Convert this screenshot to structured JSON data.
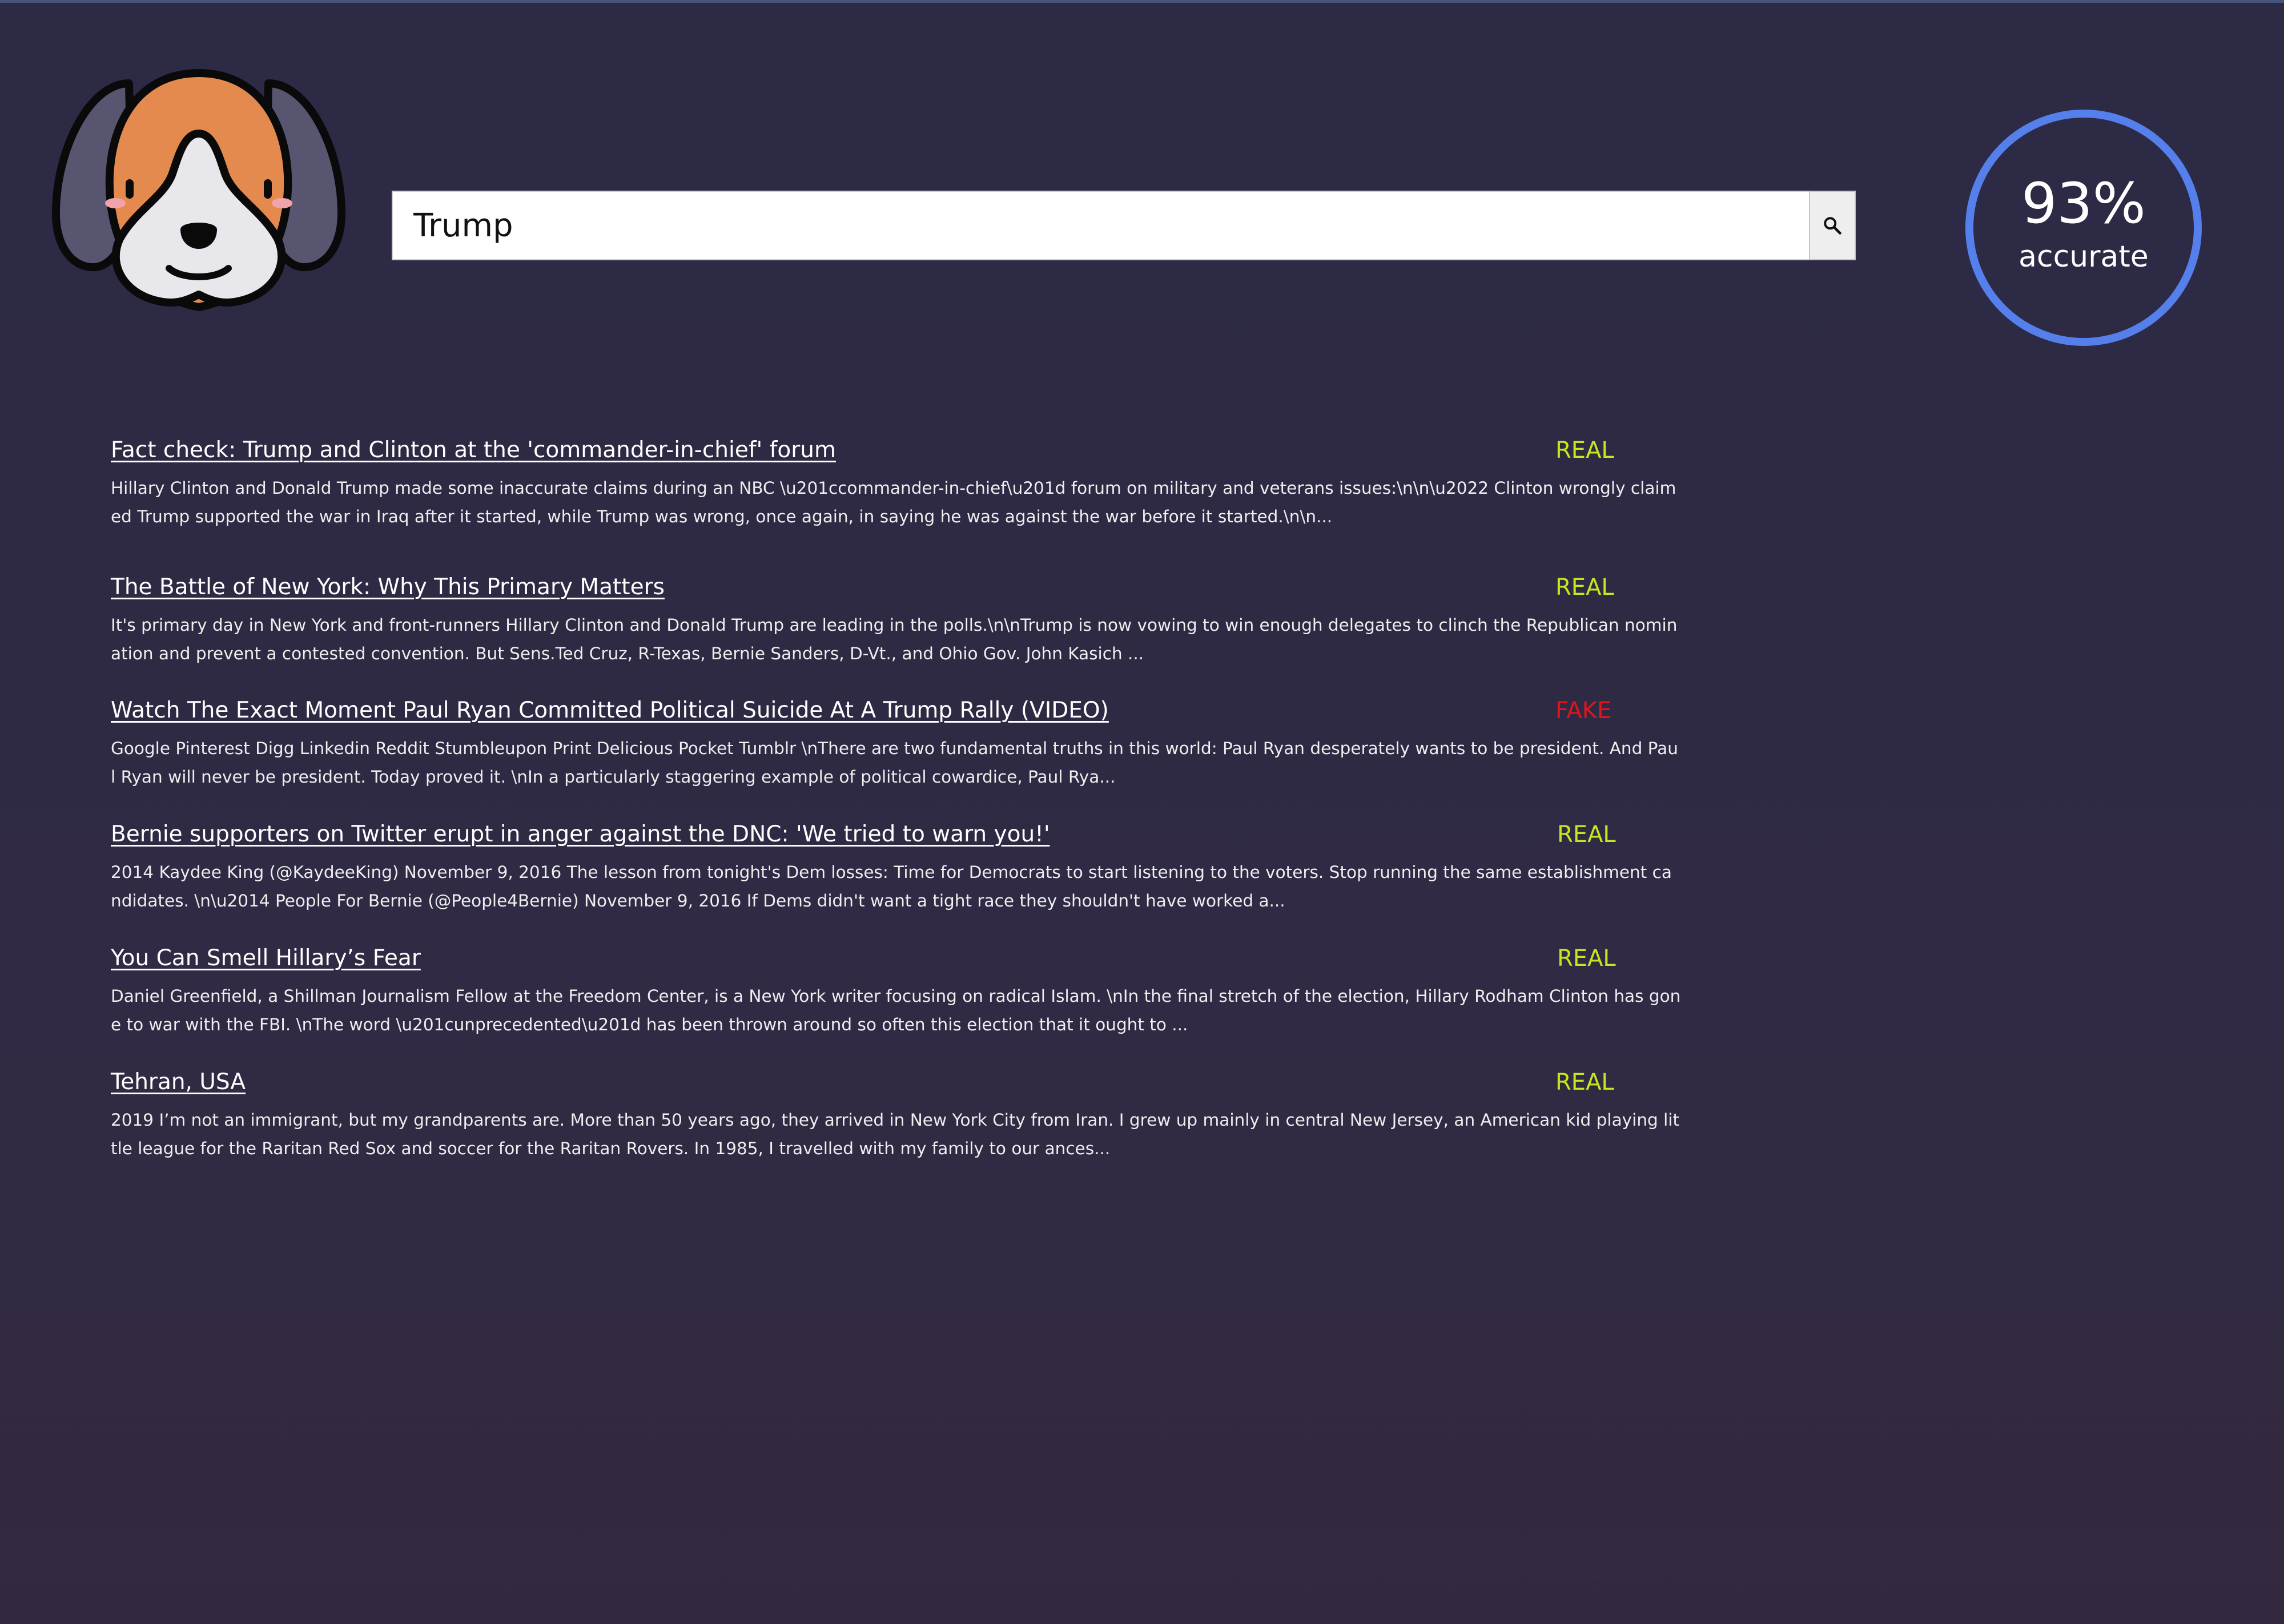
{
  "search": {
    "query": "Trump",
    "button_icon": "search-icon"
  },
  "logo": {
    "icon": "beagle-dog-icon"
  },
  "accuracy": {
    "value": "93%",
    "label": "accurate",
    "ring_color": "#5580ec"
  },
  "colors": {
    "real": "#c6e61e",
    "fake": "#e0141c",
    "background": "#2e2a44"
  },
  "results": [
    {
      "title": "Fact check: Trump and Clinton at the 'commander-in-chief' forum",
      "verdict": "REAL",
      "snippet": "Hillary Clinton and Donald Trump made some inaccurate claims during an NBC \\u201ccommander-in-chief\\u201d forum on military and veterans issues:\\n\\n\\u2022 Clinton wrongly claimed Trump supported the war in Iraq after it started, while Trump was wrong, once again, in saying he was against the war before it started.\\n\\n..."
    },
    {
      "title": "The Battle of New York: Why This Primary Matters",
      "verdict": "REAL",
      "snippet": "It's primary day in New York and front-runners Hillary Clinton and Donald Trump are leading in the polls.\\n\\nTrump is now vowing to win enough delegates to clinch the Republican nomination and prevent a contested convention. But Sens.Ted Cruz, R-Texas, Bernie Sanders, D-Vt., and Ohio Gov. John Kasich ..."
    },
    {
      "title": "Watch The Exact Moment Paul Ryan Committed Political Suicide At A Trump Rally (VIDEO)",
      "verdict": "FAKE",
      "snippet": "Google Pinterest Digg Linkedin Reddit Stumbleupon Print Delicious Pocket Tumblr \\nThere are two fundamental truths in this world: Paul Ryan desperately wants to be president. And Paul Ryan will never be president. Today proved it. \\nIn a particularly staggering example of political cowardice, Paul Rya..."
    },
    {
      "title": "Bernie supporters on Twitter erupt in anger against the DNC: 'We tried to warn you!'",
      "verdict": "REAL",
      "snippet": "2014 Kaydee King (@KaydeeKing) November 9, 2016 The lesson from tonight's Dem losses: Time for Democrats to start listening to the voters. Stop running the same establishment candidates. \\n\\u2014 People For Bernie (@People4Bernie) November 9, 2016 If Dems didn't want a tight race they shouldn't have worked a..."
    },
    {
      "title": "You Can Smell Hillary’s Fear",
      "verdict": "REAL",
      "snippet": "Daniel Greenfield, a Shillman Journalism Fellow at the Freedom Center, is a New York writer focusing on radical Islam. \\nIn the final stretch of the election, Hillary Rodham Clinton has gone to war with the FBI. \\nThe word \\u201cunprecedented\\u201d has been thrown around so often this election that it ought to ..."
    },
    {
      "title": "Tehran, USA",
      "verdict": "REAL",
      "snippet": "2019 I’m not an immigrant, but my grandparents are. More than 50 years ago, they arrived in New York City from Iran. I grew up mainly in central New Jersey, an American kid playing little league for the Raritan Red Sox and soccer for the Raritan Rovers. In 1985, I travelled with my family to our ances..."
    }
  ]
}
